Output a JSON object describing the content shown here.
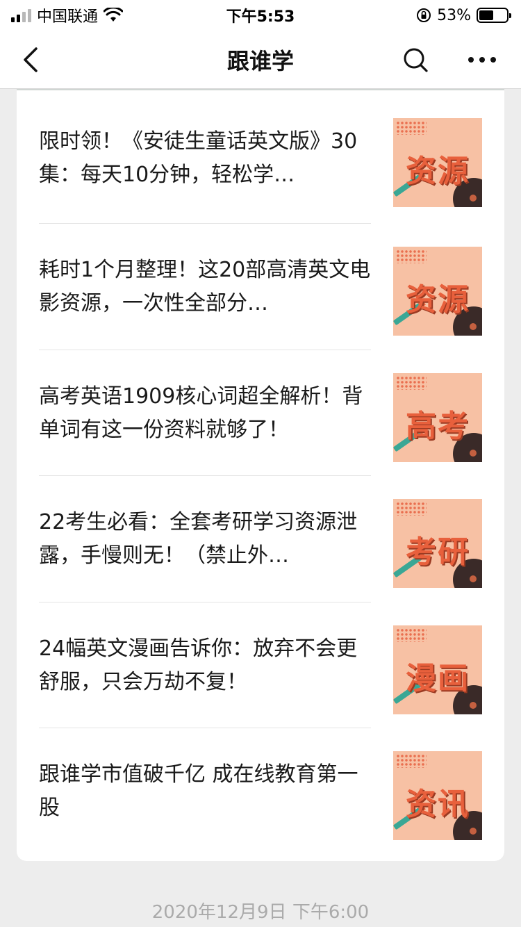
{
  "status_bar": {
    "carrier": "中国联通",
    "time": "下午5:53",
    "battery_percent": "53%",
    "battery_level": 0.53,
    "icons": [
      "signal-icon",
      "wifi-icon",
      "rotation-lock-icon",
      "battery-icon"
    ]
  },
  "nav": {
    "title": "跟谁学",
    "icons": [
      "back-icon",
      "search-icon",
      "more-icon"
    ]
  },
  "articles": [
    {
      "title": "限时领！《安徒生童话英文版》30集：每天10分钟，轻松学…",
      "thumb_tag": "资源"
    },
    {
      "title": "耗时1个月整理！这20部高清英文电影资源，一次性全部分…",
      "thumb_tag": "资源"
    },
    {
      "title": "高考英语1909核心词超全解析！背单词有这一份资料就够了！",
      "thumb_tag": "高考"
    },
    {
      "title": "22考生必看：全套考研学习资源泄露，手慢则无！（禁止外…",
      "thumb_tag": "考研"
    },
    {
      "title": "24幅英文漫画告诉你：放弃不会更舒服，只会万劫不复！",
      "thumb_tag": "漫画"
    },
    {
      "title": "跟谁学市值破千亿 成在线教育第一股",
      "thumb_tag": "资讯"
    }
  ],
  "timestamp": "2020年12月9日 下午6:00",
  "colors": {
    "background": "#ededed",
    "card": "#ffffff",
    "thumb_bg": "#f7c1a4",
    "thumb_text": "#e8603c",
    "timestamp": "#aaaaaa"
  }
}
